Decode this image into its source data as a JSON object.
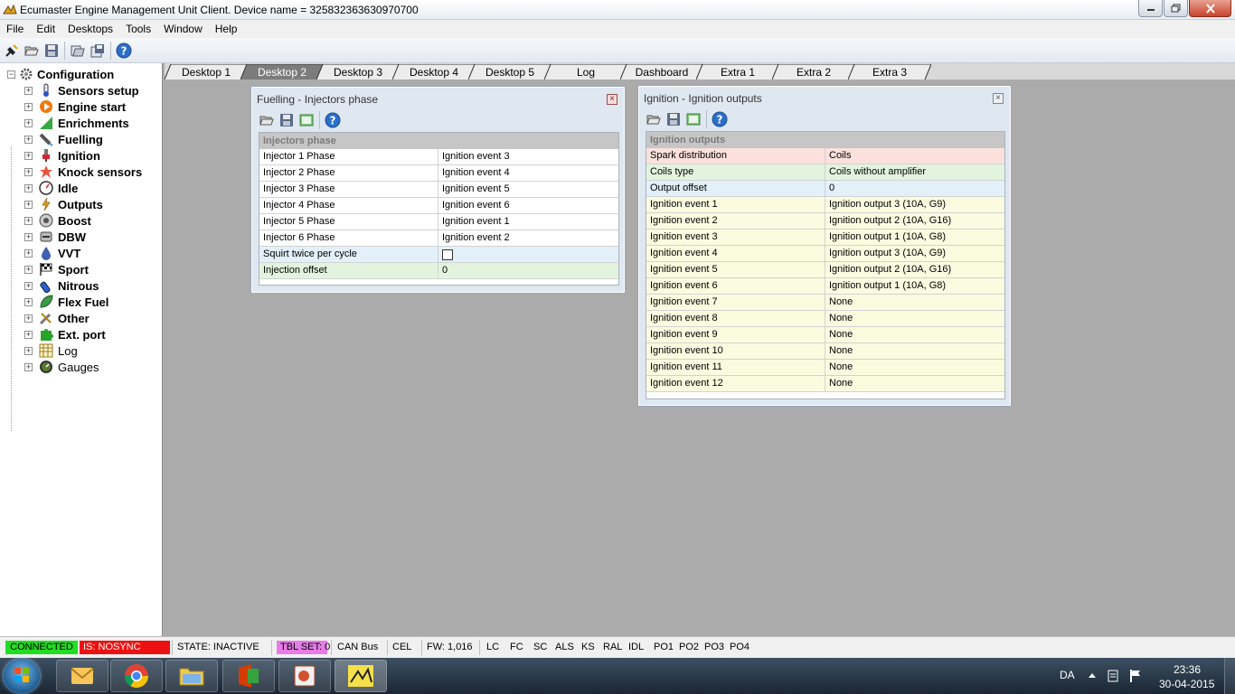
{
  "window": {
    "title": "Ecumaster Engine Management Unit Client. Device name = 325832363630970700"
  },
  "menu": [
    "File",
    "Edit",
    "Desktops",
    "Tools",
    "Window",
    "Help"
  ],
  "tree": {
    "root": "Configuration",
    "items": [
      {
        "label": "Sensors setup",
        "icon": "thermometer-icon",
        "bold": true
      },
      {
        "label": "Engine start",
        "icon": "engine-start-icon",
        "bold": true
      },
      {
        "label": "Enrichments",
        "icon": "enrichments-icon",
        "bold": true
      },
      {
        "label": "Fuelling",
        "icon": "injector-icon",
        "bold": true
      },
      {
        "label": "Ignition",
        "icon": "spark-plug-icon",
        "bold": true
      },
      {
        "label": "Knock sensors",
        "icon": "knock-icon",
        "bold": true
      },
      {
        "label": "Idle",
        "icon": "idle-gauge-icon",
        "bold": true
      },
      {
        "label": "Outputs",
        "icon": "outputs-icon",
        "bold": true
      },
      {
        "label": "Boost",
        "icon": "turbo-icon",
        "bold": true
      },
      {
        "label": "DBW",
        "icon": "throttle-icon",
        "bold": true
      },
      {
        "label": "VVT",
        "icon": "oil-drop-icon",
        "bold": true
      },
      {
        "label": "Sport",
        "icon": "checkered-flag-icon",
        "bold": true
      },
      {
        "label": "Nitrous",
        "icon": "nitrous-bottle-icon",
        "bold": true
      },
      {
        "label": "Flex Fuel",
        "icon": "leaf-icon",
        "bold": true
      },
      {
        "label": "Other",
        "icon": "tools-icon",
        "bold": true
      },
      {
        "label": "Ext. port",
        "icon": "puzzle-icon",
        "bold": true
      },
      {
        "label": "Log",
        "icon": "log-table-icon",
        "bold": false
      },
      {
        "label": "Gauges",
        "icon": "gauge-icon",
        "bold": false
      }
    ]
  },
  "tabs": [
    "Desktop 1",
    "Desktop 2",
    "Desktop 3",
    "Desktop 4",
    "Desktop 5",
    "Log",
    "Dashboard",
    "Extra 1",
    "Extra 2",
    "Extra 3"
  ],
  "active_tab": "Desktop 2",
  "fuelling_window": {
    "title": "Fuelling - Injectors phase",
    "header": "Injectors phase",
    "rows": [
      {
        "name": "Injector 1 Phase",
        "value": "Ignition event 3",
        "color": "#ffffff"
      },
      {
        "name": "Injector 2 Phase",
        "value": "Ignition event 4",
        "color": "#ffffff"
      },
      {
        "name": "Injector 3 Phase",
        "value": "Ignition event 5",
        "color": "#ffffff"
      },
      {
        "name": "Injector 4 Phase",
        "value": "Ignition event 6",
        "color": "#ffffff"
      },
      {
        "name": "Injector 5 Phase",
        "value": "Ignition event 1",
        "color": "#ffffff"
      },
      {
        "name": "Injector 6 Phase",
        "value": "Ignition event 2",
        "color": "#ffffff"
      },
      {
        "name": "Squirt twice per cycle",
        "value": "",
        "checkbox": true,
        "color": "#e2f0fa"
      },
      {
        "name": "Injection offset",
        "value": "0",
        "color": "#e3f4de"
      }
    ]
  },
  "ignition_window": {
    "title": "Ignition - Ignition outputs",
    "header": "Ignition outputs",
    "rows": [
      {
        "name": "Spark distribution",
        "value": "Coils",
        "color": "#fbe0dc"
      },
      {
        "name": "Coils type",
        "value": "Coils without amplifier",
        "color": "#e3f4de"
      },
      {
        "name": "Output offset",
        "value": "0",
        "color": "#e2f0fa"
      },
      {
        "name": "Ignition event 1",
        "value": "Ignition output 3 (10A, G9)",
        "color": "#fbfbe0"
      },
      {
        "name": "Ignition event 2",
        "value": "Ignition output 2 (10A, G16)",
        "color": "#fbfbe0"
      },
      {
        "name": "Ignition event 3",
        "value": "Ignition output 1 (10A, G8)",
        "color": "#fbfbe0"
      },
      {
        "name": "Ignition event 4",
        "value": "Ignition output 3 (10A, G9)",
        "color": "#fbfbe0"
      },
      {
        "name": "Ignition event 5",
        "value": "Ignition output 2 (10A, G16)",
        "color": "#fbfbe0"
      },
      {
        "name": "Ignition event 6",
        "value": "Ignition output 1 (10A, G8)",
        "color": "#fbfbe0"
      },
      {
        "name": "Ignition event 7",
        "value": "None",
        "color": "#fbfbe0"
      },
      {
        "name": "Ignition event 8",
        "value": "None",
        "color": "#fbfbe0"
      },
      {
        "name": "Ignition event 9",
        "value": "None",
        "color": "#fbfbe0"
      },
      {
        "name": "Ignition event 10",
        "value": "None",
        "color": "#fbfbe0"
      },
      {
        "name": "Ignition event 11",
        "value": "None",
        "color": "#fbfbe0"
      },
      {
        "name": "Ignition event 12",
        "value": "None",
        "color": "#fbfbe0"
      }
    ]
  },
  "status": {
    "connected": "CONNECTED",
    "connected_color": "#22dd22",
    "sync": "IS: NOSYNC",
    "sync_color": "#ee1111",
    "state": "STATE: INACTIVE",
    "tblset": "TBL SET: 0",
    "tblset_color": "#e77ce7",
    "canbus": "CAN Bus",
    "cel": "CEL",
    "fw": "FW: 1,016",
    "flags": [
      "LC",
      "FC",
      "SC",
      "ALS",
      "KS",
      "RAL",
      "IDL",
      "PO1",
      "PO2",
      "PO3",
      "PO4"
    ]
  },
  "taskbar": {
    "language": "DA",
    "time": "23:36",
    "date": "30-04-2015"
  }
}
